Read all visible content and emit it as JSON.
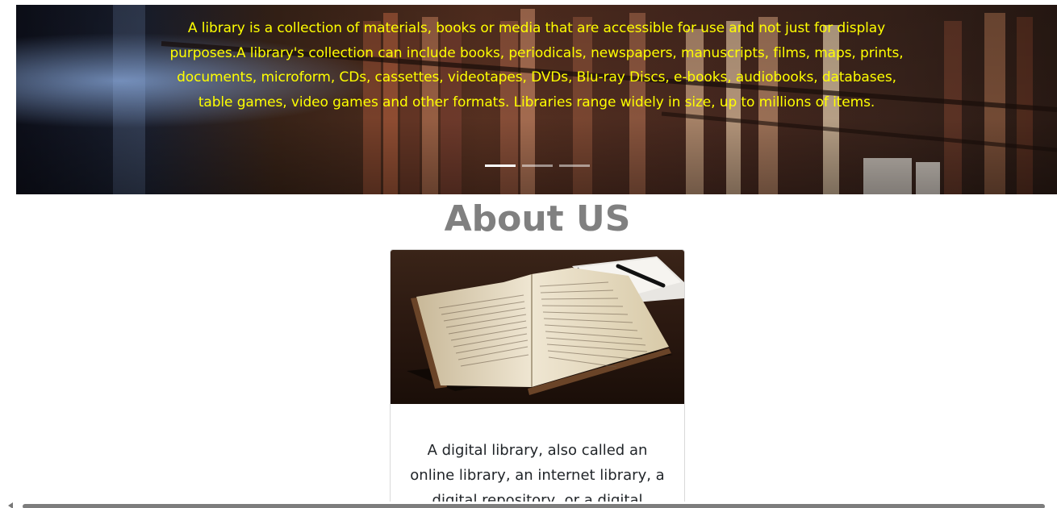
{
  "carousel": {
    "caption": "A library is a collection of materials, books or media that are accessible for use and not just for display purposes.A library's collection can include books, periodicals, newspapers, manuscripts, films, maps, prints, documents, microform, CDs, cassettes, videotapes, DVDs, Blu-ray Discs, e-books, audiobooks, databases, table games, video games and other formats. Libraries range widely in size, up to millions of items.",
    "caption_color": "#ffff00",
    "slide_count": 3,
    "active_slide": 1
  },
  "about": {
    "title": "About US",
    "card_text": "A digital library, also called an online library, an internet library, a digital repository, or a digital"
  },
  "colors": {
    "title": "#808080",
    "body_text": "#212529"
  }
}
